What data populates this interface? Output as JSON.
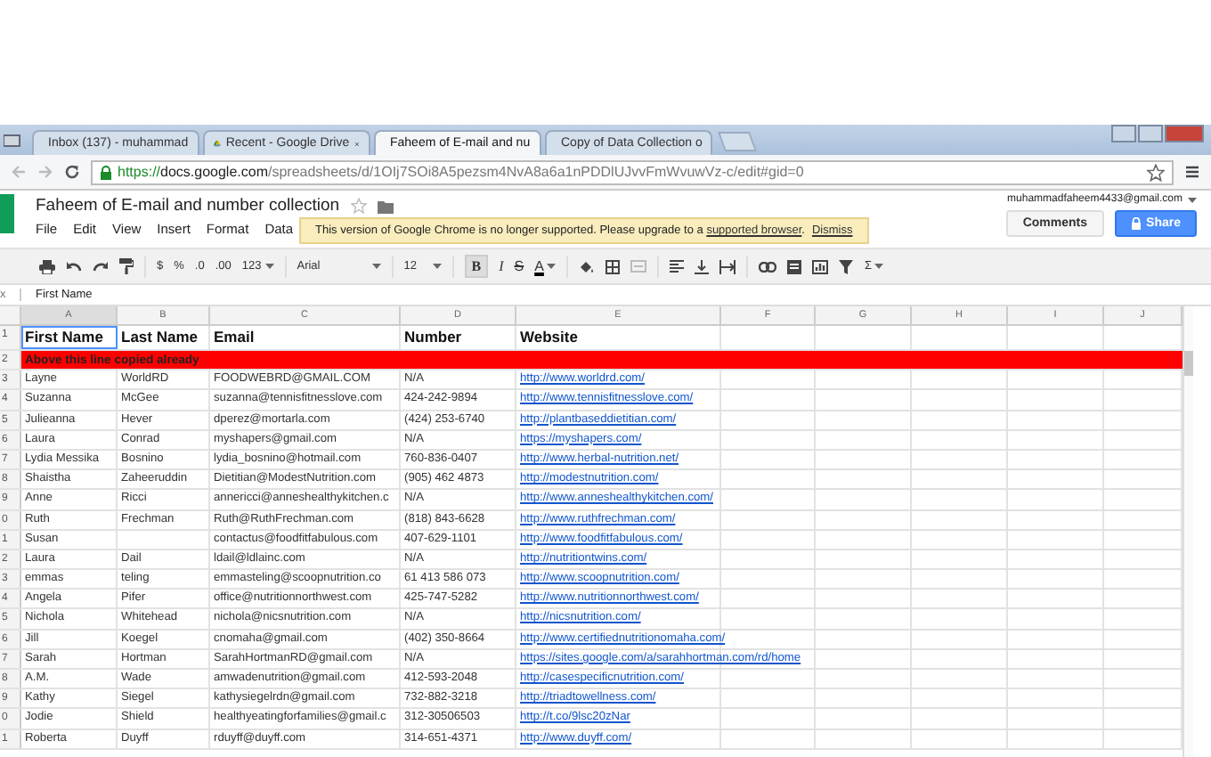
{
  "browser": {
    "tabs": [
      {
        "title": "Inbox (137) - muhammad",
        "selected": false
      },
      {
        "title": "Recent - Google Drive",
        "selected": false
      },
      {
        "title": "Faheem of E-mail and nu",
        "selected": true
      },
      {
        "title": "Copy of Data Collection o",
        "selected": false
      }
    ],
    "url_scheme": "https://",
    "url_host": "docs.google.com",
    "url_path": "/spreadsheets/d/1OIj7SOi8A5pezsm4NvA8a6a1nPDDlUJvvFmWvuwVz-c/edit#gid=0"
  },
  "document": {
    "title": "Faheem of E-mail and number collection",
    "account": "muhammadfaheem4433@gmail.com",
    "menus": [
      "File",
      "Edit",
      "View",
      "Insert",
      "Format",
      "Data"
    ],
    "notice": {
      "text": "This version of Google Chrome is no longer supported. Please upgrade to a",
      "link": "supported browser",
      "after_link": ".",
      "dismiss": "Dismiss"
    },
    "buttons": {
      "comments": "Comments",
      "share": "Share"
    }
  },
  "toolbar": {
    "currency": "$",
    "percent": "%",
    "decrease_decimals": ".0",
    "increase_decimals": ".00",
    "more_formats": "123",
    "font": "Arial",
    "font_size": "12",
    "bold": "B",
    "bold_active": true,
    "italic": "I",
    "strikethrough": "S",
    "text_color": "A",
    "functions": "Σ"
  },
  "formula_bar": {
    "label": "x",
    "value": "First Name"
  },
  "sheet": {
    "columns": [
      "A",
      "B",
      "C",
      "D",
      "E",
      "F",
      "G",
      "H",
      "I",
      "J"
    ],
    "header_row": {
      "number": "1",
      "cells": [
        "First Name",
        "Last Name",
        "Email",
        "Number",
        "Website"
      ]
    },
    "banner_row": {
      "number": "2",
      "text": "Above this line copied already",
      "color": "#ff0000"
    },
    "rows": [
      {
        "number": "3",
        "first": "Layne",
        "last": "WorldRD",
        "email": "FOODWEBRD@GMAIL.COM",
        "phone": "N/A",
        "website": "http://www.worldrd.com/"
      },
      {
        "number": "4",
        "first": "Suzanna",
        "last": "McGee",
        "email": "suzanna@tennisfitnesslove.com",
        "phone": "424-242-9894",
        "website": "http://www.tennisfitnesslove.com/"
      },
      {
        "number": "5",
        "first": "Julieanna",
        "last": "Hever",
        "email": "dperez@mortarla.com",
        "phone": "(424) 253-6740",
        "website": "http://plantbaseddietitian.com/"
      },
      {
        "number": "6",
        "first": "Laura",
        "last": "Conrad",
        "email": "myshapers@gmail.com",
        "phone": "N/A",
        "website": "https://myshapers.com/"
      },
      {
        "number": "7",
        "first": "Lydia Messika",
        "last": "Bosnino",
        "email": "lydia_bosnino@hotmail.com",
        "phone": "760-836-0407",
        "website": "http://www.herbal-nutrition.net/"
      },
      {
        "number": "8",
        "first": "Shaistha",
        "last": "Zaheeruddin",
        "email": "Dietitian@ModestNutrition.com",
        "phone": "(905) 462 4873",
        "website": "http://modestnutrition.com/"
      },
      {
        "number": "9",
        "first": "Anne",
        "last": "Ricci",
        "email": "annericci@anneshealthykitchen.c",
        "phone": "N/A",
        "website": "http://www.anneshealthykitchen.com/"
      },
      {
        "number": "0",
        "first": "Ruth",
        "last": "Frechman",
        "email": "Ruth@RuthFrechman.com",
        "phone": "(818) 843-6628",
        "website": "http://www.ruthfrechman.com/"
      },
      {
        "number": "1",
        "first": "Susan",
        "last": "",
        "email": "contactus@foodfitfabulous.com",
        "phone": "407-629-1101",
        "website": "http://www.foodfitfabulous.com/"
      },
      {
        "number": "2",
        "first": "Laura",
        "last": "Dail",
        "email": "ldail@ldlainc.com",
        "phone": "N/A",
        "website": "http://nutritiontwins.com/"
      },
      {
        "number": "3",
        "first": "emmas",
        "last": "teling",
        "email": "emmasteling@scoopnutrition.co",
        "phone": "61 413 586 073",
        "website": "http://www.scoopnutrition.com/"
      },
      {
        "number": "4",
        "first": "Angela",
        "last": "Pifer",
        "email": "office@nutritionnorthwest.com",
        "phone": "425-747-5282",
        "website": "http://www.nutritionnorthwest.com/"
      },
      {
        "number": "5",
        "first": "Nichola",
        "last": "Whitehead",
        "email": "nichola@nicsnutrition.com",
        "phone": "N/A",
        "website": "http://nicsnutrition.com/"
      },
      {
        "number": "6",
        "first": "Jill",
        "last": "Koegel",
        "email": "cnomaha@gmail.com",
        "phone": "(402) 350-8664",
        "website": "http://www.certifiednutritionomaha.com/"
      },
      {
        "number": "7",
        "first": "Sarah",
        "last": "Hortman",
        "email": "SarahHortmanRD@gmail.com",
        "phone": "N/A",
        "website": "https://sites.google.com/a/sarahhortman.com/rd/home"
      },
      {
        "number": "8",
        "first": "A.M.",
        "last": "Wade",
        "email": "amwadenutrition@gmail.com",
        "phone": "412-593-2048",
        "website": "http://casespecificnutrition.com/"
      },
      {
        "number": "9",
        "first": "Kathy",
        "last": "Siegel",
        "email": "kathysiegelrdn@gmail.com",
        "phone": "732-882-3218",
        "website": "http://triadtowellness.com/"
      },
      {
        "number": "0",
        "first": "Jodie",
        "last": "Shield",
        "email": "healthyeatingforfamilies@gmail.c",
        "phone": "312-30506503",
        "website": "http://t.co/9lsc20zNar"
      },
      {
        "number": "1",
        "first": "Roberta",
        "last": "Duyff",
        "email": "rduyff@duyff.com",
        "phone": "314-651-4371",
        "website": "http://www.duyff.com/"
      }
    ]
  }
}
